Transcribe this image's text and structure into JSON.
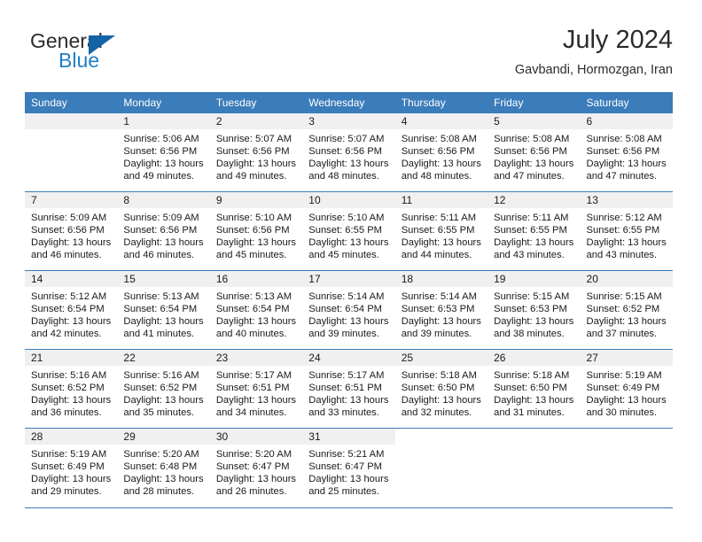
{
  "brand": {
    "name_part1": "General",
    "name_part2": "Blue",
    "flag_icon": "flag-triangle-icon",
    "colors": {
      "blue": "#1f7fc4",
      "flag": "#1464a5",
      "text": "#2b2b2b"
    }
  },
  "header": {
    "title": "July 2024",
    "location": "Gavbandi, Hormozgan, Iran"
  },
  "theme": {
    "header_blue": "#3b7cba",
    "daynum_band": "#f0f0f0",
    "rule_blue": "#3b7cba"
  },
  "calendar": {
    "weekday_headers": [
      "Sunday",
      "Monday",
      "Tuesday",
      "Wednesday",
      "Thursday",
      "Friday",
      "Saturday"
    ],
    "weeks": [
      [
        {
          "day": "",
          "sunrise": "",
          "sunset": "",
          "daylight_line1": "",
          "daylight_line2": ""
        },
        {
          "day": "1",
          "sunrise": "Sunrise: 5:06 AM",
          "sunset": "Sunset: 6:56 PM",
          "daylight_line1": "Daylight: 13 hours",
          "daylight_line2": "and 49 minutes."
        },
        {
          "day": "2",
          "sunrise": "Sunrise: 5:07 AM",
          "sunset": "Sunset: 6:56 PM",
          "daylight_line1": "Daylight: 13 hours",
          "daylight_line2": "and 49 minutes."
        },
        {
          "day": "3",
          "sunrise": "Sunrise: 5:07 AM",
          "sunset": "Sunset: 6:56 PM",
          "daylight_line1": "Daylight: 13 hours",
          "daylight_line2": "and 48 minutes."
        },
        {
          "day": "4",
          "sunrise": "Sunrise: 5:08 AM",
          "sunset": "Sunset: 6:56 PM",
          "daylight_line1": "Daylight: 13 hours",
          "daylight_line2": "and 48 minutes."
        },
        {
          "day": "5",
          "sunrise": "Sunrise: 5:08 AM",
          "sunset": "Sunset: 6:56 PM",
          "daylight_line1": "Daylight: 13 hours",
          "daylight_line2": "and 47 minutes."
        },
        {
          "day": "6",
          "sunrise": "Sunrise: 5:08 AM",
          "sunset": "Sunset: 6:56 PM",
          "daylight_line1": "Daylight: 13 hours",
          "daylight_line2": "and 47 minutes."
        }
      ],
      [
        {
          "day": "7",
          "sunrise": "Sunrise: 5:09 AM",
          "sunset": "Sunset: 6:56 PM",
          "daylight_line1": "Daylight: 13 hours",
          "daylight_line2": "and 46 minutes."
        },
        {
          "day": "8",
          "sunrise": "Sunrise: 5:09 AM",
          "sunset": "Sunset: 6:56 PM",
          "daylight_line1": "Daylight: 13 hours",
          "daylight_line2": "and 46 minutes."
        },
        {
          "day": "9",
          "sunrise": "Sunrise: 5:10 AM",
          "sunset": "Sunset: 6:56 PM",
          "daylight_line1": "Daylight: 13 hours",
          "daylight_line2": "and 45 minutes."
        },
        {
          "day": "10",
          "sunrise": "Sunrise: 5:10 AM",
          "sunset": "Sunset: 6:55 PM",
          "daylight_line1": "Daylight: 13 hours",
          "daylight_line2": "and 45 minutes."
        },
        {
          "day": "11",
          "sunrise": "Sunrise: 5:11 AM",
          "sunset": "Sunset: 6:55 PM",
          "daylight_line1": "Daylight: 13 hours",
          "daylight_line2": "and 44 minutes."
        },
        {
          "day": "12",
          "sunrise": "Sunrise: 5:11 AM",
          "sunset": "Sunset: 6:55 PM",
          "daylight_line1": "Daylight: 13 hours",
          "daylight_line2": "and 43 minutes."
        },
        {
          "day": "13",
          "sunrise": "Sunrise: 5:12 AM",
          "sunset": "Sunset: 6:55 PM",
          "daylight_line1": "Daylight: 13 hours",
          "daylight_line2": "and 43 minutes."
        }
      ],
      [
        {
          "day": "14",
          "sunrise": "Sunrise: 5:12 AM",
          "sunset": "Sunset: 6:54 PM",
          "daylight_line1": "Daylight: 13 hours",
          "daylight_line2": "and 42 minutes."
        },
        {
          "day": "15",
          "sunrise": "Sunrise: 5:13 AM",
          "sunset": "Sunset: 6:54 PM",
          "daylight_line1": "Daylight: 13 hours",
          "daylight_line2": "and 41 minutes."
        },
        {
          "day": "16",
          "sunrise": "Sunrise: 5:13 AM",
          "sunset": "Sunset: 6:54 PM",
          "daylight_line1": "Daylight: 13 hours",
          "daylight_line2": "and 40 minutes."
        },
        {
          "day": "17",
          "sunrise": "Sunrise: 5:14 AM",
          "sunset": "Sunset: 6:54 PM",
          "daylight_line1": "Daylight: 13 hours",
          "daylight_line2": "and 39 minutes."
        },
        {
          "day": "18",
          "sunrise": "Sunrise: 5:14 AM",
          "sunset": "Sunset: 6:53 PM",
          "daylight_line1": "Daylight: 13 hours",
          "daylight_line2": "and 39 minutes."
        },
        {
          "day": "19",
          "sunrise": "Sunrise: 5:15 AM",
          "sunset": "Sunset: 6:53 PM",
          "daylight_line1": "Daylight: 13 hours",
          "daylight_line2": "and 38 minutes."
        },
        {
          "day": "20",
          "sunrise": "Sunrise: 5:15 AM",
          "sunset": "Sunset: 6:52 PM",
          "daylight_line1": "Daylight: 13 hours",
          "daylight_line2": "and 37 minutes."
        }
      ],
      [
        {
          "day": "21",
          "sunrise": "Sunrise: 5:16 AM",
          "sunset": "Sunset: 6:52 PM",
          "daylight_line1": "Daylight: 13 hours",
          "daylight_line2": "and 36 minutes."
        },
        {
          "day": "22",
          "sunrise": "Sunrise: 5:16 AM",
          "sunset": "Sunset: 6:52 PM",
          "daylight_line1": "Daylight: 13 hours",
          "daylight_line2": "and 35 minutes."
        },
        {
          "day": "23",
          "sunrise": "Sunrise: 5:17 AM",
          "sunset": "Sunset: 6:51 PM",
          "daylight_line1": "Daylight: 13 hours",
          "daylight_line2": "and 34 minutes."
        },
        {
          "day": "24",
          "sunrise": "Sunrise: 5:17 AM",
          "sunset": "Sunset: 6:51 PM",
          "daylight_line1": "Daylight: 13 hours",
          "daylight_line2": "and 33 minutes."
        },
        {
          "day": "25",
          "sunrise": "Sunrise: 5:18 AM",
          "sunset": "Sunset: 6:50 PM",
          "daylight_line1": "Daylight: 13 hours",
          "daylight_line2": "and 32 minutes."
        },
        {
          "day": "26",
          "sunrise": "Sunrise: 5:18 AM",
          "sunset": "Sunset: 6:50 PM",
          "daylight_line1": "Daylight: 13 hours",
          "daylight_line2": "and 31 minutes."
        },
        {
          "day": "27",
          "sunrise": "Sunrise: 5:19 AM",
          "sunset": "Sunset: 6:49 PM",
          "daylight_line1": "Daylight: 13 hours",
          "daylight_line2": "and 30 minutes."
        }
      ],
      [
        {
          "day": "28",
          "sunrise": "Sunrise: 5:19 AM",
          "sunset": "Sunset: 6:49 PM",
          "daylight_line1": "Daylight: 13 hours",
          "daylight_line2": "and 29 minutes."
        },
        {
          "day": "29",
          "sunrise": "Sunrise: 5:20 AM",
          "sunset": "Sunset: 6:48 PM",
          "daylight_line1": "Daylight: 13 hours",
          "daylight_line2": "and 28 minutes."
        },
        {
          "day": "30",
          "sunrise": "Sunrise: 5:20 AM",
          "sunset": "Sunset: 6:47 PM",
          "daylight_line1": "Daylight: 13 hours",
          "daylight_line2": "and 26 minutes."
        },
        {
          "day": "31",
          "sunrise": "Sunrise: 5:21 AM",
          "sunset": "Sunset: 6:47 PM",
          "daylight_line1": "Daylight: 13 hours",
          "daylight_line2": "and 25 minutes."
        },
        {
          "day": "",
          "sunrise": "",
          "sunset": "",
          "daylight_line1": "",
          "daylight_line2": ""
        },
        {
          "day": "",
          "sunrise": "",
          "sunset": "",
          "daylight_line1": "",
          "daylight_line2": ""
        },
        {
          "day": "",
          "sunrise": "",
          "sunset": "",
          "daylight_line1": "",
          "daylight_line2": ""
        }
      ]
    ]
  }
}
